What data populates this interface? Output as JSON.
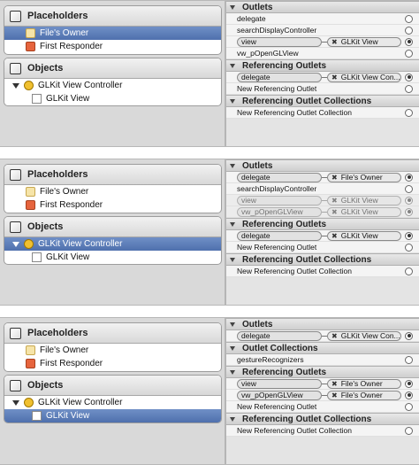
{
  "panels": [
    {
      "placeholders": {
        "title": "Placeholders",
        "items": [
          {
            "label": "File's Owner",
            "selected": true
          },
          {
            "label": "First Responder",
            "selected": false
          }
        ]
      },
      "objects": {
        "title": "Objects",
        "controller": "GLKit View Controller",
        "view": "GLKit View",
        "controller_selected": false,
        "view_selected": false
      },
      "outlets": {
        "title": "Outlets",
        "rows": [
          {
            "name": "delegate",
            "target": ""
          },
          {
            "name": "searchDisplayController",
            "target": ""
          },
          {
            "name": "view",
            "target": "GLKit View"
          },
          {
            "name": "vw_pOpenGLView",
            "target": ""
          }
        ]
      },
      "referencing": {
        "title": "Referencing Outlets",
        "rows": [
          {
            "name": "delegate",
            "target": "GLKit View Con..."
          },
          {
            "name": "New Referencing Outlet",
            "target": ""
          }
        ]
      },
      "collections": {
        "title": "Referencing Outlet Collections",
        "rows": [
          {
            "name": "New Referencing Outlet Collection"
          }
        ]
      }
    },
    {
      "placeholders": {
        "title": "Placeholders",
        "items": [
          {
            "label": "File's Owner"
          },
          {
            "label": "First Responder"
          }
        ]
      },
      "objects": {
        "title": "Objects",
        "controller": "GLKit View Controller",
        "view": "GLKit View"
      },
      "outlets": {
        "title": "Outlets",
        "rows": [
          {
            "name": "delegate",
            "target": "File's Owner"
          },
          {
            "name": "searchDisplayController",
            "target": ""
          },
          {
            "name": "view",
            "target": "GLKit View"
          },
          {
            "name": "vw_pOpenGLView",
            "target": "GLKit View"
          }
        ]
      },
      "referencing": {
        "title": "Referencing Outlets",
        "rows": [
          {
            "name": "delegate",
            "target": "GLKit View"
          },
          {
            "name": "New Referencing Outlet",
            "target": ""
          }
        ]
      },
      "collections": {
        "title": "Referencing Outlet Collections",
        "rows": [
          {
            "name": "New Referencing Outlet Collection"
          }
        ]
      }
    },
    {
      "placeholders": {
        "title": "Placeholders",
        "items": [
          {
            "label": "File's Owner"
          },
          {
            "label": "First Responder"
          }
        ]
      },
      "objects": {
        "title": "Objects",
        "controller": "GLKit View Controller",
        "view": "GLKit View"
      },
      "outlets": {
        "title": "Outlets",
        "rows": [
          {
            "name": "delegate",
            "target": "GLKit View Con..."
          }
        ]
      },
      "outlet_collections": {
        "title": "Outlet Collections",
        "rows": [
          {
            "name": "gestureRecognizers"
          }
        ]
      },
      "referencing": {
        "title": "Referencing Outlets",
        "rows": [
          {
            "name": "view",
            "target": "File's Owner"
          },
          {
            "name": "vw_pOpenGLView",
            "target": "File's Owner"
          },
          {
            "name": "New Referencing Outlet",
            "target": ""
          }
        ]
      },
      "collections": {
        "title": "Referencing Outlet Collections",
        "rows": [
          {
            "name": "New Referencing Outlet Collection"
          }
        ]
      }
    }
  ],
  "colors": {
    "selection": "#5877b5",
    "panel_bg": "#d9d9d9"
  },
  "icons": {
    "placeholder": "cube-icon",
    "owner": "files-owner-icon",
    "responder": "first-responder-icon",
    "controller": "view-controller-icon",
    "view": "view-icon",
    "disconnect": "x-icon",
    "connection": "circle-icon"
  }
}
